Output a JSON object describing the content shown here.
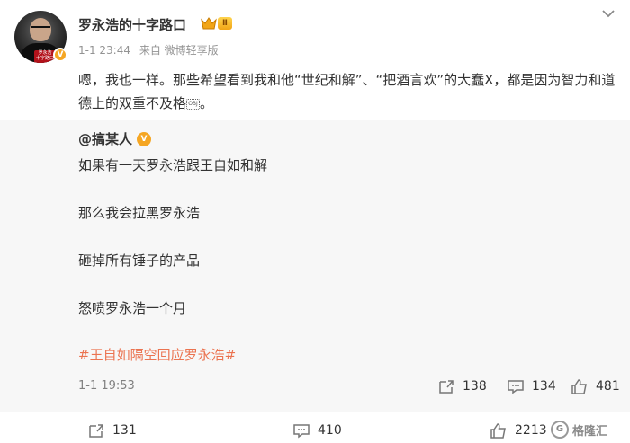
{
  "post": {
    "username": "罗永浩的十字路口",
    "level_badge": "Ⅱ",
    "time": "1-1 23:44",
    "source": "来自 微博轻享版",
    "text_before_emoji": "嗯，我也一样。那些希望看到我和他“世纪和解”、“把酒言欢”的大蠢X，都是因为智力和道德上的双重不及格",
    "emoji_label": "OBJ",
    "text_after_emoji": "。",
    "avatar_sign_line1": "罗永浩",
    "avatar_sign_line2": "十字路口",
    "actions": {
      "repost_count": "131",
      "comment_count": "410",
      "like_count": "2213"
    }
  },
  "repost": {
    "author": "@搞某人",
    "lines": [
      "如果有一天罗永浩跟王自如和解",
      "那么我会拉黑罗永浩",
      "砸掉所有锤子的产品",
      "怒喷罗永浩一个月"
    ],
    "hashtag": "#王自如隔空回应罗永浩#",
    "time": "1-1 19:53",
    "actions": {
      "repost_count": "138",
      "comment_count": "134",
      "like_count": "481"
    }
  },
  "watermark": {
    "text": "格隆汇",
    "logo": "G"
  },
  "colors": {
    "hashtag": "#eb7350",
    "verified": "#f5a623",
    "repost_bg": "#f7f7f7",
    "meta": "#939393"
  },
  "icons": [
    "verified-icon",
    "crown-icon",
    "more-icon",
    "repost-icon",
    "comment-icon",
    "like-icon"
  ]
}
